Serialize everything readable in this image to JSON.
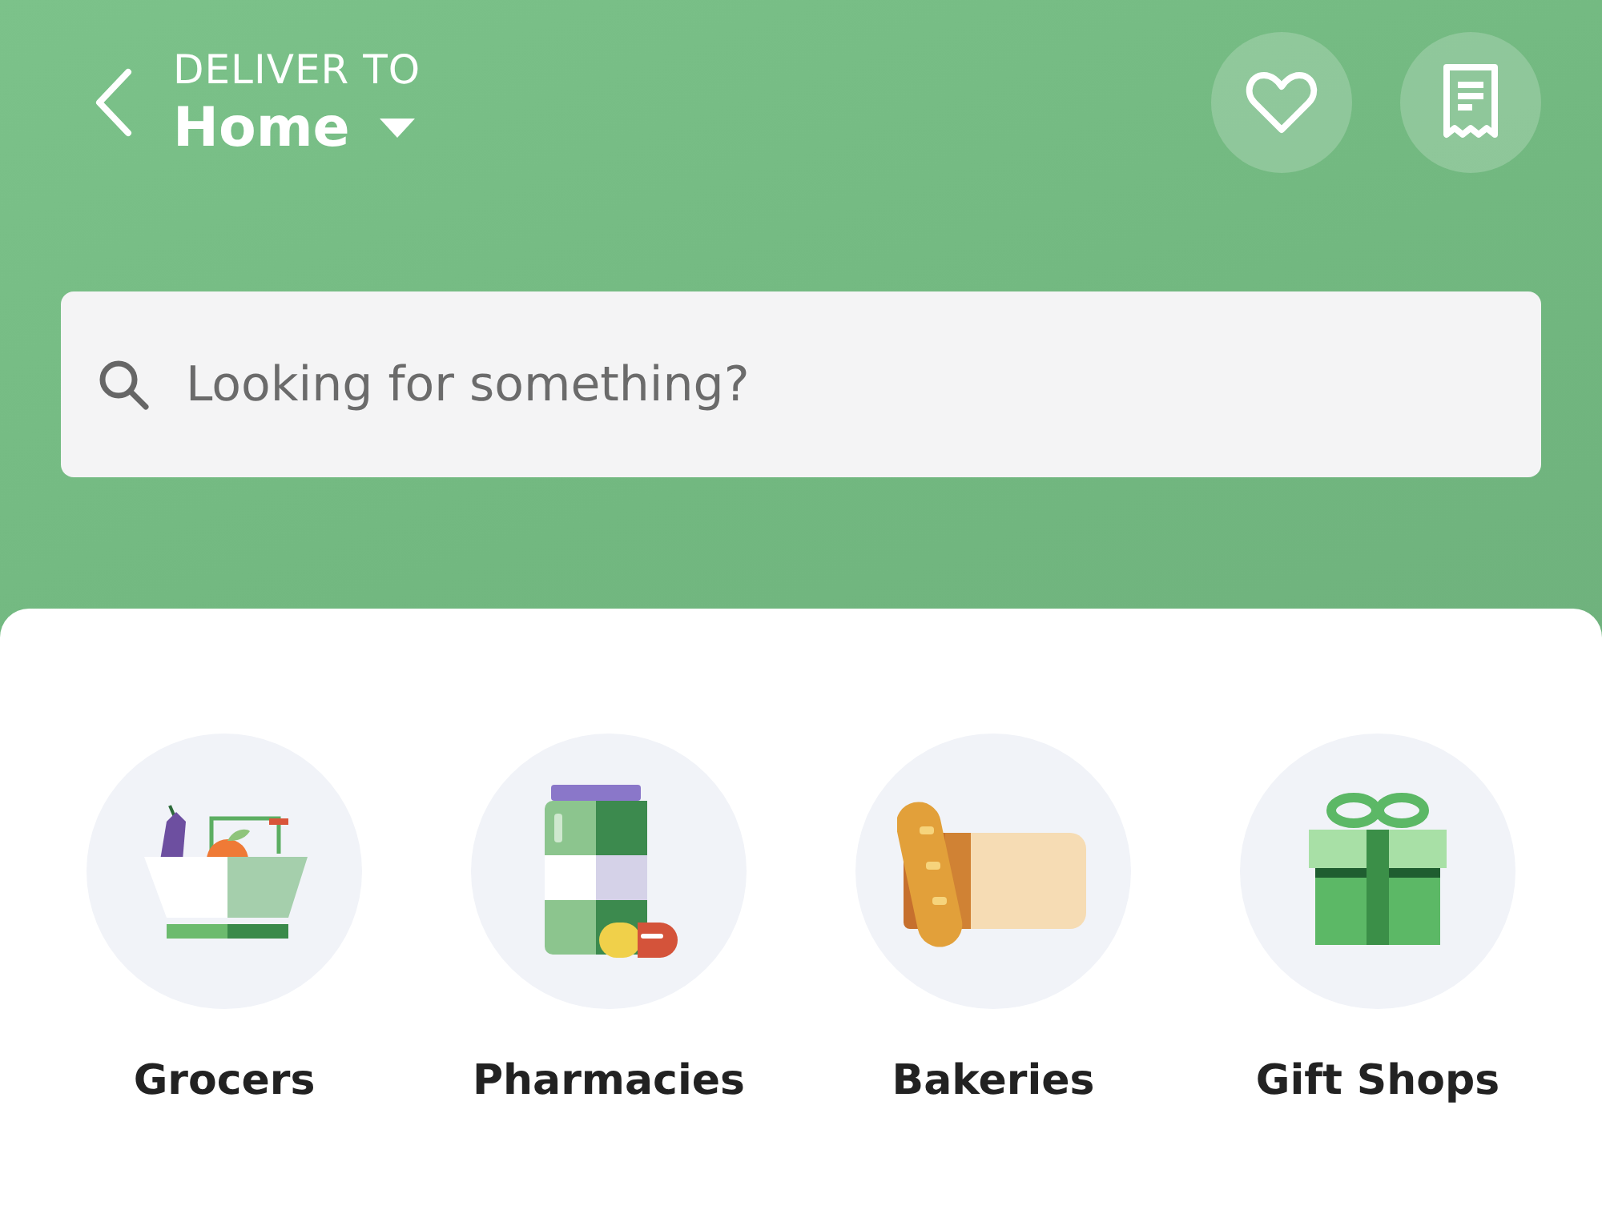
{
  "header": {
    "eyebrow": "DELIVER TO",
    "location": "Home"
  },
  "search": {
    "placeholder": "Looking for something?"
  },
  "categories": [
    {
      "kind": "grocer",
      "label": "Grocers"
    },
    {
      "kind": "pharmacy",
      "label": "Pharmacies"
    },
    {
      "kind": "bakery",
      "label": "Bakeries"
    },
    {
      "kind": "gift",
      "label": "Gift Shops"
    }
  ]
}
